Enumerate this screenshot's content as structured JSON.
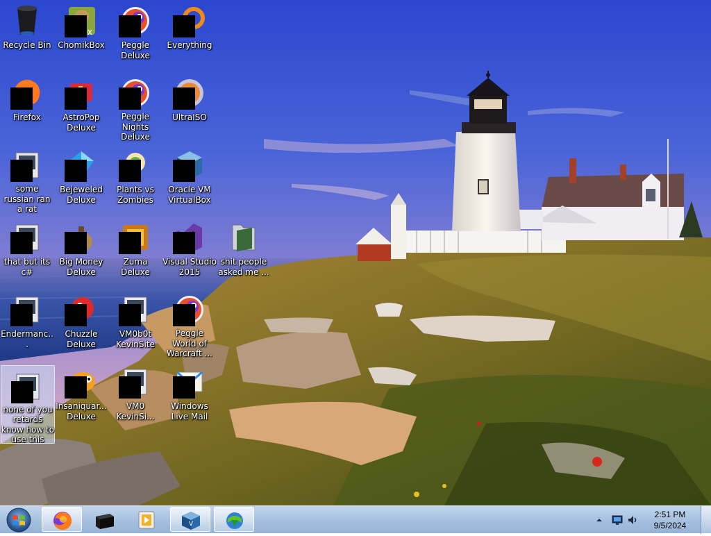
{
  "desktop": {
    "icons": [
      {
        "label": "Recycle Bin",
        "icon": "recycle-bin-icon"
      },
      {
        "label": "ChomikBox",
        "icon": "chomikbox-icon"
      },
      {
        "label": "Peggle Deluxe",
        "icon": "peggle-icon"
      },
      {
        "label": "Everything",
        "icon": "everything-icon"
      },
      {
        "label": "Firefox",
        "icon": "firefox-icon"
      },
      {
        "label": "AstroPop Deluxe",
        "icon": "astropop-icon"
      },
      {
        "label": "Peggle Nights Deluxe",
        "icon": "peggle-nights-icon"
      },
      {
        "label": "UltraISO",
        "icon": "ultraiso-icon"
      },
      {
        "label": "some russian ran a rat",
        "icon": "shortcut-icon"
      },
      {
        "label": "Bejeweled Deluxe",
        "icon": "bejeweled-icon"
      },
      {
        "label": "Plants vs Zombies",
        "icon": "plants-vs-zombies-icon"
      },
      {
        "label": "Oracle VM VirtualBox",
        "icon": "virtualbox-icon"
      },
      {
        "label": "that but its c#",
        "icon": "shortcut-icon"
      },
      {
        "label": "Big Money Deluxe",
        "icon": "big-money-icon"
      },
      {
        "label": "Zuma Deluxe",
        "icon": "zuma-icon"
      },
      {
        "label": "Visual Studio 2015",
        "icon": "visual-studio-icon"
      },
      {
        "label": "shit people asked me ...",
        "icon": "folder-icon"
      },
      {
        "label": "Endermanc...",
        "icon": "shortcut-icon"
      },
      {
        "label": "Chuzzle Deluxe",
        "icon": "chuzzle-icon"
      },
      {
        "label": "VM0b0t KevinSite",
        "icon": "shortcut-icon"
      },
      {
        "label": "Peggle World of Warcraft ...",
        "icon": "peggle-wow-icon"
      },
      {
        "label": "none of you retards know how to use this",
        "icon": "shortcut-icon"
      },
      {
        "label": "Insaniquar... Deluxe",
        "icon": "insaniquarium-icon"
      },
      {
        "label": "VM0 KevinSi...",
        "icon": "shortcut-icon"
      },
      {
        "label": "Windows Live Mail",
        "icon": "windows-live-mail-icon"
      }
    ]
  },
  "taskbar": {
    "pinned": [
      {
        "name": "firefox",
        "icon": "firefox-icon",
        "active": true
      },
      {
        "name": "terminal",
        "icon": "terminal-icon",
        "active": false
      },
      {
        "name": "media-player",
        "icon": "media-player-icon",
        "active": false
      },
      {
        "name": "virtualbox",
        "icon": "virtualbox-icon",
        "active": true
      },
      {
        "name": "download-manager",
        "icon": "download-manager-icon",
        "active": true
      }
    ],
    "tray": {
      "time": "2:51 PM",
      "date": "9/5/2024"
    }
  },
  "colors": {
    "sky_top": "#2f4fd6",
    "sky_horizon": "#c89ec8",
    "sea": "#2a4a9a",
    "grass": "#8a7a2a",
    "taskbar": "#a7c1df",
    "redaction": "#000000"
  }
}
